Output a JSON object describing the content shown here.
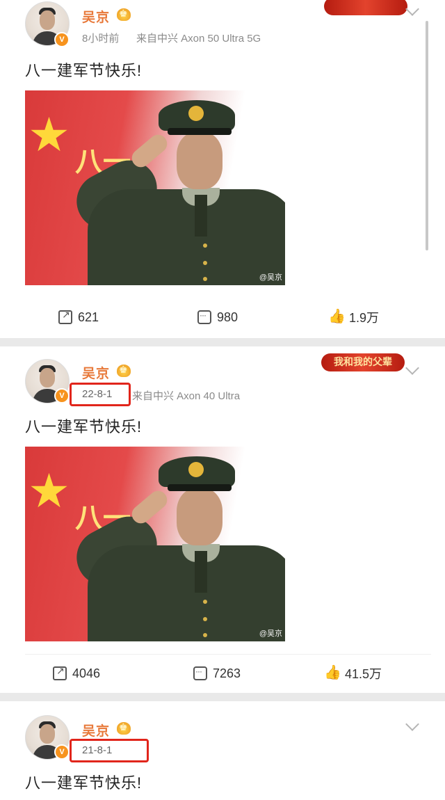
{
  "posts": [
    {
      "username": "吴京",
      "time": "8小时前",
      "source": "来自中兴 Axon 50 Ultra 5G",
      "text": "八一建军节快乐!",
      "photo_watermark": "@吴京",
      "banner": "",
      "actions": {
        "share": "621",
        "comment": "980",
        "like": "1.9万"
      }
    },
    {
      "username": "吴京",
      "time": "22-8-1",
      "source": "来自中兴 Axon 40 Ultra",
      "text": "八一建军节快乐!",
      "photo_watermark": "@吴京",
      "banner": "我和我的父辈",
      "actions": {
        "share": "4046",
        "comment": "7263",
        "like": "41.5万"
      }
    },
    {
      "username": "吴京",
      "time": "21-8-1",
      "source": "",
      "text": "八一建军节快乐!"
    }
  ],
  "colors": {
    "username": "#e8793a",
    "highlight_box": "#e1251b",
    "divider": "#e9e9e9",
    "banner": "#c52b1b"
  },
  "icons": [
    "share-icon",
    "comment-icon",
    "like-icon",
    "chevron-down-icon",
    "crown-icon",
    "verified-badge-icon"
  ]
}
